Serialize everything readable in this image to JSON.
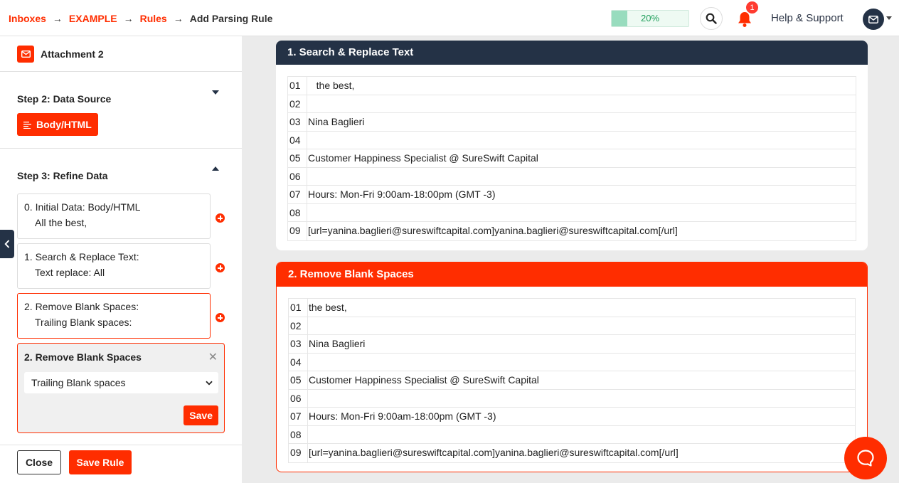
{
  "breadcrumb": {
    "items": [
      "Inboxes",
      "EXAMPLE",
      "Rules"
    ],
    "current": "Add Parsing Rule",
    "separator": "→"
  },
  "header": {
    "progress_label": "20%",
    "progress_value": 0.2,
    "notification_count": "1",
    "help_label": "Help & Support"
  },
  "sidebar": {
    "attachment_label": "Attachment 2",
    "step2_title": "Step 2: Data Source",
    "data_source_button": "Body/HTML",
    "step3_title": "Step 3: Refine Data",
    "refine_items": [
      {
        "title": "0. Initial Data: Body/HTML",
        "subtitle": "All the best,"
      },
      {
        "title": "1. Search & Replace Text:",
        "subtitle": "Text replace: All"
      },
      {
        "title": "2. Remove Blank Spaces:",
        "subtitle": "Trailing Blank spaces:"
      }
    ],
    "editor": {
      "title": "2. Remove Blank Spaces",
      "selected_option": "Trailing Blank spaces",
      "save_label": "Save"
    },
    "close_label": "Close",
    "save_rule_label": "Save Rule"
  },
  "panels": [
    {
      "title": "1. Search & Replace Text",
      "lines": [
        {
          "num": "01",
          "text": "   the best,"
        },
        {
          "num": "02",
          "text": ""
        },
        {
          "num": "03",
          "text": "Nina Baglieri"
        },
        {
          "num": "04",
          "text": ""
        },
        {
          "num": "05",
          "text": "Customer Happiness Specialist @ SureSwift Capital"
        },
        {
          "num": "06",
          "text": ""
        },
        {
          "num": "07",
          "text": "Hours: Mon-Fri 9:00am-18:00pm (GMT -3)"
        },
        {
          "num": "08",
          "text": ""
        },
        {
          "num": "09",
          "text": "[url=yanina.baglieri@sureswiftcapital.com]yanina.baglieri@sureswiftcapital.com[/url]"
        }
      ]
    },
    {
      "title": "2. Remove Blank Spaces",
      "lines": [
        {
          "num": "01",
          "text": "the best,"
        },
        {
          "num": "02",
          "text": ""
        },
        {
          "num": "03",
          "text": "Nina Baglieri"
        },
        {
          "num": "04",
          "text": ""
        },
        {
          "num": "05",
          "text": "Customer Happiness Specialist @ SureSwift Capital"
        },
        {
          "num": "06",
          "text": ""
        },
        {
          "num": "07",
          "text": "Hours: Mon-Fri 9:00am-18:00pm (GMT -3)"
        },
        {
          "num": "08",
          "text": ""
        },
        {
          "num": "09",
          "text": "[url=yanina.baglieri@sureswiftcapital.com]yanina.baglieri@sureswiftcapital.com[/url]"
        }
      ]
    }
  ],
  "colors": {
    "accent": "#ff2d00",
    "navy": "#243246",
    "progress_fill": "#98dcbe",
    "progress_text": "#1e9e5a"
  },
  "icons": {
    "attachment": "mail-icon",
    "search": "search-icon",
    "notifications": "bell-icon",
    "avatar": "mail-icon",
    "collapse": "chevron-left-icon",
    "chat": "chat-icon"
  }
}
